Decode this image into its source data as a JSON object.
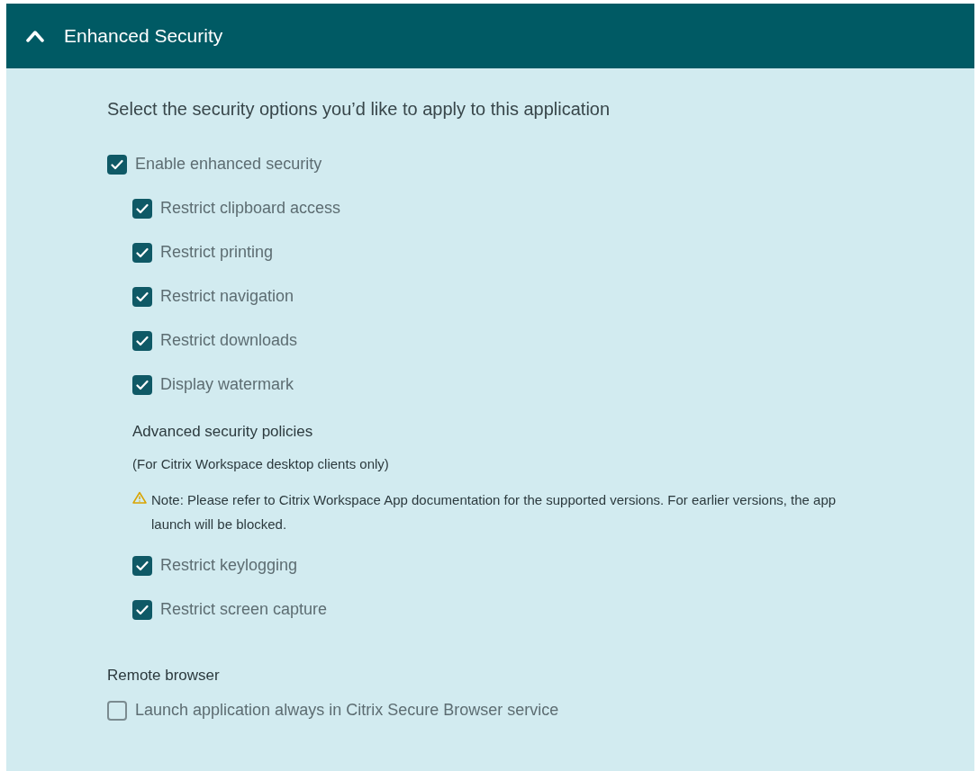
{
  "panel": {
    "title": "Enhanced Security",
    "expanded": true
  },
  "intro": "Select the security options you’d like to apply to this application",
  "items": [
    {
      "kind": "checkbox",
      "label": "Enable enhanced security",
      "checked": true,
      "children": [
        {
          "kind": "checkbox",
          "label": "Restrict clipboard access",
          "checked": true
        },
        {
          "kind": "checkbox",
          "label": "Restrict printing",
          "checked": true
        },
        {
          "kind": "checkbox",
          "label": "Restrict navigation",
          "checked": true
        },
        {
          "kind": "checkbox",
          "label": "Restrict downloads",
          "checked": true
        },
        {
          "kind": "checkbox",
          "label": "Display watermark",
          "checked": true
        },
        {
          "kind": "heading",
          "label": "Advanced security policies"
        },
        {
          "kind": "text",
          "label": "(For Citrix Workspace desktop clients only)"
        },
        {
          "kind": "warning",
          "label": "Note: Please refer to Citrix Workspace App documentation for the supported versions. For earlier versions, the app launch will be blocked."
        },
        {
          "kind": "checkbox",
          "label": "Restrict keylogging",
          "checked": true
        },
        {
          "kind": "checkbox",
          "label": "Restrict screen capture",
          "checked": true
        }
      ]
    },
    {
      "kind": "heading",
      "label": "Remote browser"
    },
    {
      "kind": "checkbox",
      "label": "Launch application always in Citrix Secure Browser service",
      "checked": false
    }
  ]
}
